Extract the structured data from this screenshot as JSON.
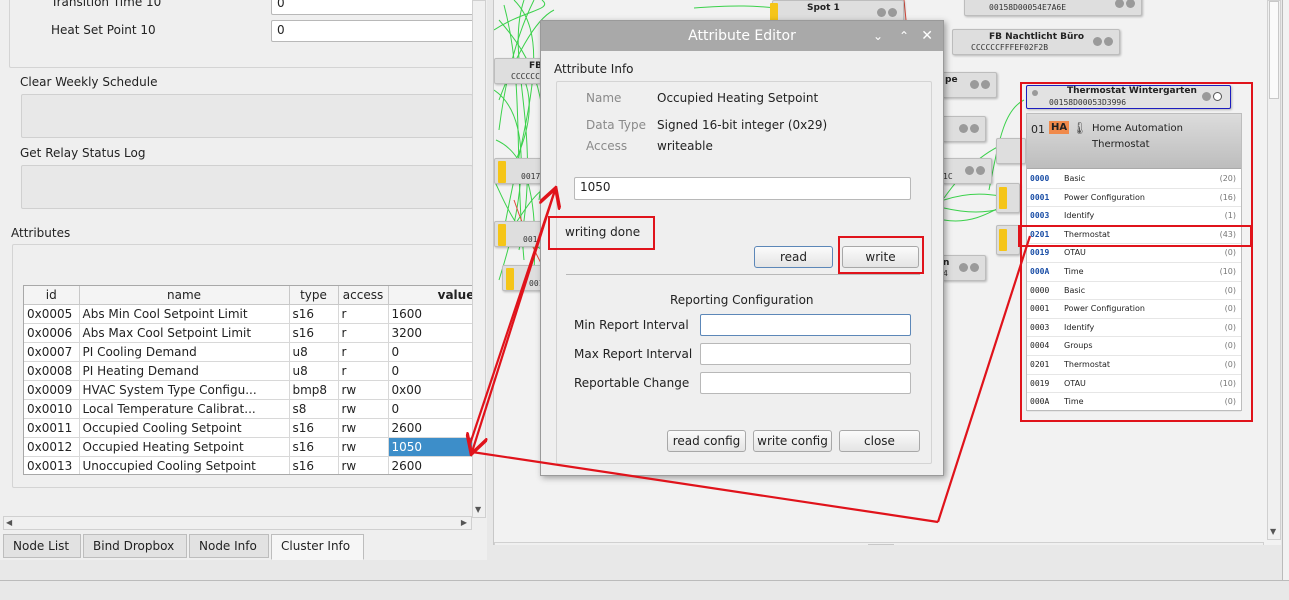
{
  "left": {
    "fields": [
      {
        "label": "Transition Time 10",
        "value": "0"
      },
      {
        "label": "Heat Set Point 10",
        "value": "0"
      }
    ],
    "commands": [
      "Clear Weekly Schedule",
      "Get Relay Status Log"
    ],
    "attributes_title": "Attributes",
    "table": {
      "headers": [
        "id",
        "name",
        "type",
        "access",
        "value"
      ],
      "rows": [
        {
          "id": "0x0005",
          "name": "Abs Min Cool Setpoint Limit",
          "type": "s16",
          "access": "r",
          "value": "1600"
        },
        {
          "id": "0x0006",
          "name": "Abs Max Cool Setpoint Limit",
          "type": "s16",
          "access": "r",
          "value": "3200"
        },
        {
          "id": "0x0007",
          "name": "PI Cooling Demand",
          "type": "u8",
          "access": "r",
          "value": "0"
        },
        {
          "id": "0x0008",
          "name": "PI Heating Demand",
          "type": "u8",
          "access": "r",
          "value": "0"
        },
        {
          "id": "0x0009",
          "name": "HVAC System Type Configu...",
          "type": "bmp8",
          "access": "rw",
          "value": "0x00"
        },
        {
          "id": "0x0010",
          "name": "Local Temperature Calibrat...",
          "type": "s8",
          "access": "rw",
          "value": "0"
        },
        {
          "id": "0x0011",
          "name": "Occupied Cooling Setpoint",
          "type": "s16",
          "access": "rw",
          "value": "2600"
        },
        {
          "id": "0x0012",
          "name": "Occupied Heating Setpoint",
          "type": "s16",
          "access": "rw",
          "value": "1050"
        },
        {
          "id": "0x0013",
          "name": "Unoccupied Cooling Setpoint",
          "type": "s16",
          "access": "rw",
          "value": "2600"
        }
      ],
      "selected_index": 7
    },
    "tabs": [
      {
        "label": "Node List",
        "active": false
      },
      {
        "label": "Bind Dropbox",
        "active": false
      },
      {
        "label": "Node Info",
        "active": false
      },
      {
        "label": "Cluster Info",
        "active": true
      }
    ]
  },
  "graph": {
    "nodes": [
      {
        "title": "Spot 1",
        "mac": ""
      },
      {
        "title": "",
        "mac": "00158D00054E7A6E"
      },
      {
        "title": "FB Nachtlicht Büro",
        "mac": "CCCCCCFFFEF02F2B"
      },
      {
        "title": "FB",
        "mac": "CCCCCC"
      },
      {
        "title": "pe",
        "mac": ""
      },
      {
        "title": "Thermostat Wintergarten",
        "mac": "00158D00053D3996"
      }
    ],
    "partial_labels": [
      "0017",
      "001",
      "001",
      "1C",
      "4",
      "n"
    ],
    "thermostat_panel": {
      "endpoint": "01",
      "badge": "HA",
      "profile": "Home Automation Thermostat",
      "clusters": [
        {
          "id": "0000",
          "name": "Basic",
          "count": "(20)",
          "side": "server"
        },
        {
          "id": "0001",
          "name": "Power Configuration",
          "count": "(16)",
          "side": "server"
        },
        {
          "id": "0003",
          "name": "Identify",
          "count": "(1)",
          "side": "server"
        },
        {
          "id": "0201",
          "name": "Thermostat",
          "count": "(43)",
          "side": "server"
        },
        {
          "id": "0019",
          "name": "OTAU",
          "count": "(0)",
          "side": "server"
        },
        {
          "id": "000A",
          "name": "Time",
          "count": "(10)",
          "side": "server"
        },
        {
          "id": "0000",
          "name": "Basic",
          "count": "(0)",
          "side": "client"
        },
        {
          "id": "0001",
          "name": "Power Configuration",
          "count": "(0)",
          "side": "client"
        },
        {
          "id": "0003",
          "name": "Identify",
          "count": "(0)",
          "side": "client"
        },
        {
          "id": "0004",
          "name": "Groups",
          "count": "(0)",
          "side": "client"
        },
        {
          "id": "0201",
          "name": "Thermostat",
          "count": "(0)",
          "side": "client"
        },
        {
          "id": "0019",
          "name": "OTAU",
          "count": "(10)",
          "side": "client"
        },
        {
          "id": "000A",
          "name": "Time",
          "count": "(0)",
          "side": "client"
        }
      ]
    }
  },
  "dialog": {
    "title": "Attribute Editor",
    "section_info": "Attribute Info",
    "name_label": "Name",
    "name_value": "Occupied Heating Setpoint",
    "type_label": "Data Type",
    "type_value": "Signed 16-bit integer (0x29)",
    "access_label": "Access",
    "access_value": "writeable",
    "value": "1050",
    "status": "writing done",
    "read_label": "read",
    "write_label": "write",
    "reporting_title": "Reporting Configuration",
    "min_label": "Min Report Interval",
    "max_label": "Max Report Interval",
    "change_label": "Reportable Change",
    "min_value": "",
    "max_value": "",
    "change_value": "",
    "read_config_label": "read config",
    "write_config_label": "write config",
    "close_label": "close"
  },
  "colors": {
    "highlight": "#e0131b",
    "selection": "#3d8ec9",
    "accent_yellow": "#f5c518",
    "link_green": "#3bd14b"
  }
}
